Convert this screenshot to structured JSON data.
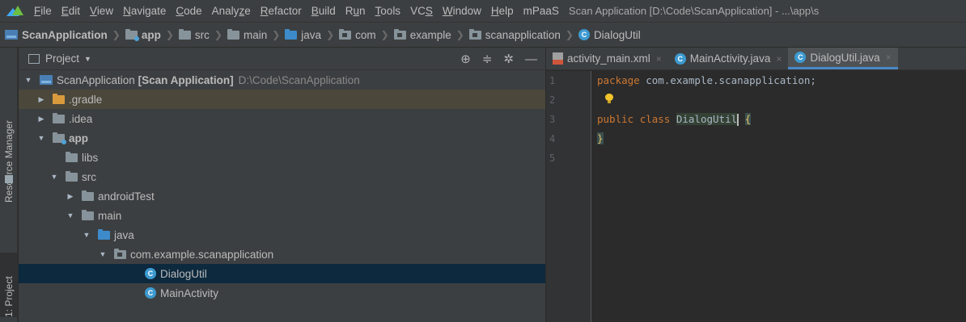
{
  "menubar": {
    "items": [
      {
        "u": "F",
        "rest": "ile"
      },
      {
        "u": "E",
        "rest": "dit"
      },
      {
        "u": "V",
        "rest": "iew"
      },
      {
        "u": "N",
        "rest": "avigate"
      },
      {
        "u": "C",
        "rest": "ode"
      },
      {
        "pre": "Analy",
        "u": "z",
        "rest": "e"
      },
      {
        "u": "R",
        "rest": "efactor"
      },
      {
        "u": "B",
        "rest": "uild"
      },
      {
        "pre": "R",
        "u": "u",
        "rest": "n"
      },
      {
        "u": "T",
        "rest": "ools"
      },
      {
        "pre": "VC",
        "u": "S",
        "rest": ""
      },
      {
        "u": "W",
        "rest": "indow"
      },
      {
        "u": "H",
        "rest": "elp"
      },
      {
        "pre": "mPaaS",
        "u": "",
        "rest": ""
      }
    ],
    "window_title": "Scan Application [D:\\Code\\ScanApplication] - ...\\app\\s"
  },
  "breadcrumb": {
    "items": [
      "ScanApplication",
      "app",
      "src",
      "main",
      "java",
      "com",
      "example",
      "scanapplication",
      "DialogUtil"
    ]
  },
  "toolstrip": {
    "resource_manager": "Resource Manager",
    "project": "1: Project"
  },
  "project_panel": {
    "title": "Project",
    "header_icons": [
      "crosshair-icon",
      "collapse-icon",
      "gear-icon",
      "minimize-icon"
    ],
    "root_name": "ScanApplication",
    "root_label": "[Scan Application]",
    "root_path": "D:\\Code\\ScanApplication",
    "nodes": {
      "gradle": ".gradle",
      "idea": ".idea",
      "app": "app",
      "libs": "libs",
      "src": "src",
      "androidTest": "androidTest",
      "main": "main",
      "java": "java",
      "package": "com.example.scanapplication",
      "dialogutil": "DialogUtil",
      "mainactivity": "MainActivity"
    }
  },
  "editor": {
    "tabs": [
      {
        "label": "activity_main.xml",
        "icon": "xml-file-icon",
        "close": "×"
      },
      {
        "label": "MainActivity.java",
        "icon": "class-icon",
        "close": "×"
      },
      {
        "label": "DialogUtil.java",
        "icon": "class-icon",
        "close": "×",
        "active": true
      }
    ],
    "line_numbers": [
      "1",
      "2",
      "3",
      "4",
      "5"
    ],
    "code": {
      "l1_kw": "package",
      "l1_rest": " com.example.scanapplication;",
      "l3_kw1": "public",
      "l3_kw2": "class",
      "l3_cls": "DialogUtil",
      "l3_brace": "{",
      "l4_brace": "}"
    }
  },
  "colors": {
    "background": "#2b2b2b",
    "panel": "#3c3f41",
    "selection": "#0d293e",
    "keyword": "#cc7832",
    "accent": "#4a88c7"
  }
}
